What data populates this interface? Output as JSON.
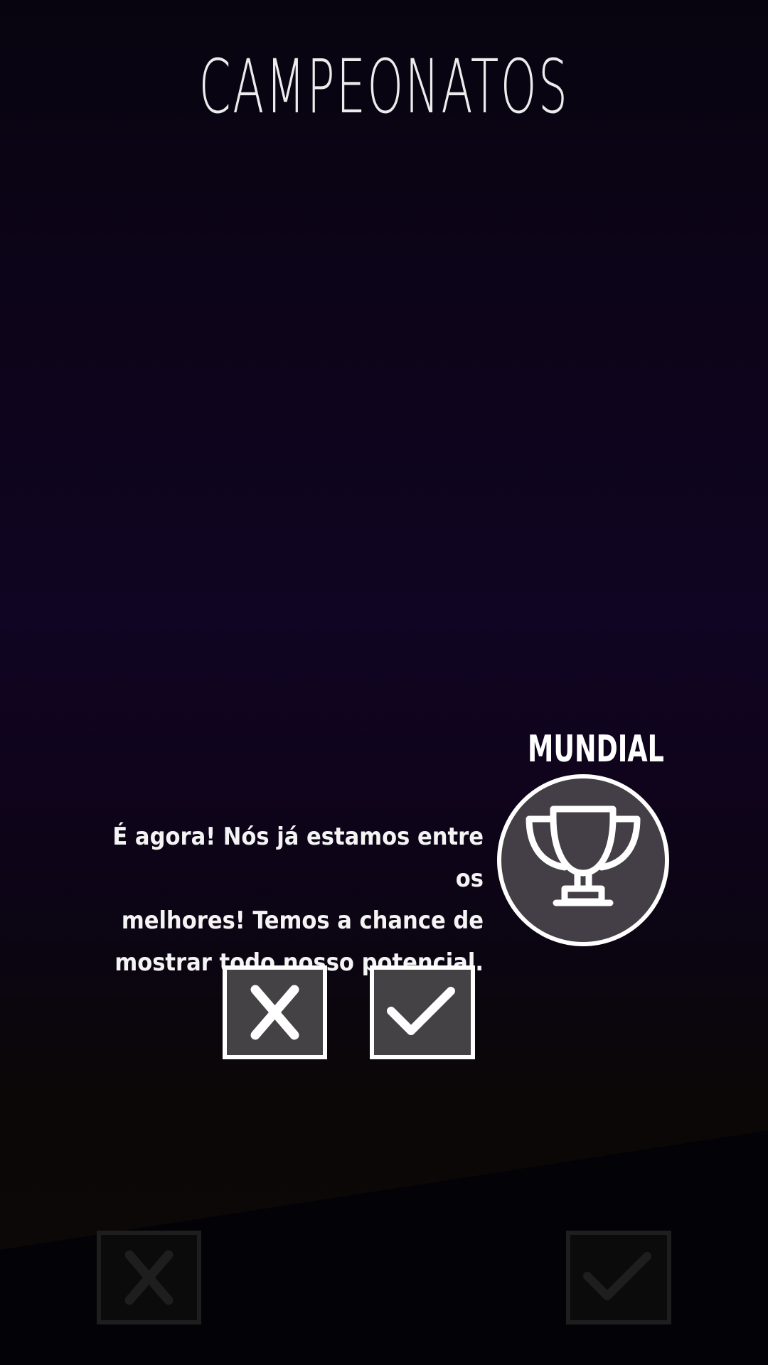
{
  "screen": {
    "title": "CAMPEONATOS"
  },
  "championship_card": {
    "label": "MUNDIAL",
    "icon": "trophy-icon",
    "message_lines": [
      "É agora! Nós já estamos entre os",
      "melhores! Temos a chance de",
      "mostrar todo nosso potencial."
    ]
  },
  "dialog_buttons": {
    "reject_icon": "close-icon",
    "accept_icon": "check-icon"
  },
  "bottom_buttons": {
    "reject_icon": "close-icon",
    "accept_icon": "check-icon"
  },
  "colors": {
    "background_top": "#07040f",
    "background_mid": "#100522",
    "background_bottom": "#0c0807",
    "badge_fill": "#443e47",
    "button_fill": "#454246",
    "faded_button_fill": "#0b0b0b",
    "faded_button_stroke": "#1e1e1e",
    "stroke_white": "#ffffff"
  }
}
